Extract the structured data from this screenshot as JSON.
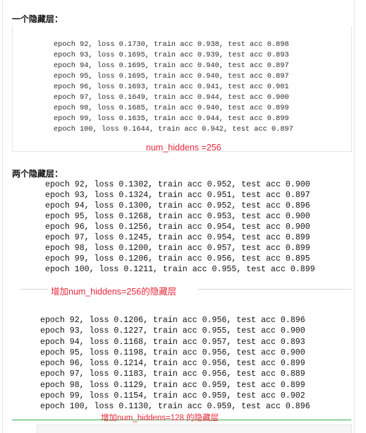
{
  "section1": {
    "heading": "一个隐藏层：",
    "log": [
      "epoch 92, loss 0.1730, train acc 0.938, test acc 0.898",
      "epoch 93, loss 0.1695, train acc 0.939, test acc 0.893",
      "epoch 94, loss 0.1695, train acc 0.940, test acc 0.897",
      "epoch 95, loss 0.1695, train acc 0.940, test acc 0.897",
      "epoch 96, loss 0.1693, train acc 0.941, test acc 0.901",
      "epoch 97, loss 0.1649, train acc 0.944, test acc 0.900",
      "epoch 98, loss 0.1685, train acc 0.940, test acc 0.899",
      "epoch 99, loss 0.1635, train acc 0.944, test acc 0.899",
      "epoch 100, loss 0.1644, train acc 0.942, test acc 0.897"
    ],
    "caption": "num_hiddens =256"
  },
  "section2": {
    "heading": "两个隐藏层：",
    "log_a": [
      "epoch 92, loss 0.1302, train acc 0.952, test acc 0.900",
      "epoch 93, loss 0.1324, train acc 0.951, test acc 0.897",
      "epoch 94, loss 0.1300, train acc 0.952, test acc 0.896",
      "epoch 95, loss 0.1268, train acc 0.953, test acc 0.900",
      "epoch 96, loss 0.1256, train acc 0.954, test acc 0.900",
      "epoch 97, loss 0.1245, train acc 0.954, test acc 0.899",
      "epoch 98, loss 0.1200, train acc 0.957, test acc 0.899",
      "epoch 99, loss 0.1206, train acc 0.956, test acc 0.895",
      "epoch 100, loss 0.1211, train acc 0.955, test acc 0.899"
    ],
    "caption_a": "增加num_hiddens=256的隐藏层",
    "log_b": [
      "epoch 92, loss 0.1206, train acc 0.956, test acc 0.896",
      "epoch 93, loss 0.1227, train acc 0.955, test acc 0.900",
      "epoch 94, loss 0.1168, train acc 0.957, test acc 0.893",
      "epoch 95, loss 0.1198, train acc 0.956, test acc 0.900",
      "epoch 96, loss 0.1214, train acc 0.956, test acc 0.899",
      "epoch 97, loss 0.1183, train acc 0.956, test acc 0.889",
      "epoch 98, loss 0.1129, train acc 0.959, test acc 0.899",
      "epoch 99, loss 0.1154, train acc 0.959, test acc 0.902",
      "epoch 100, loss 0.1130, train acc 0.959, test acc 0.896"
    ],
    "caption_b": "增加num_hiddens=128 的隐藏层"
  },
  "colors": {
    "caption": "#e8273a",
    "rule_bottom": "#35b04a"
  }
}
